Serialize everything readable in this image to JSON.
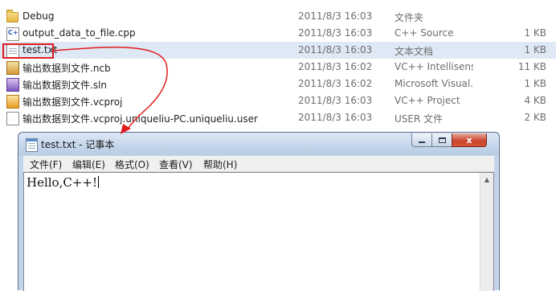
{
  "files": [
    {
      "name": "Debug",
      "date": "2011/8/3 16:03",
      "type": "文件夹",
      "size": "",
      "icon": "folder-icon"
    },
    {
      "name": "output_data_to_file.cpp",
      "date": "2011/8/3 16:03",
      "type": "C++ Source",
      "size": "1 KB",
      "icon": "cpp-file-icon"
    },
    {
      "name": "test.txt",
      "date": "2011/8/3 16:03",
      "type": "文本文档",
      "size": "1 KB",
      "icon": "text-file-icon"
    },
    {
      "name": "输出数据到文件.ncb",
      "date": "2011/8/3 16:02",
      "type": "VC++ Intellisens...",
      "size": "11 KB",
      "icon": "ncb-file-icon"
    },
    {
      "name": "输出数据到文件.sln",
      "date": "2011/8/3 16:02",
      "type": "Microsoft Visual...",
      "size": "1 KB",
      "icon": "sln-file-icon"
    },
    {
      "name": "输出数据到文件.vcproj",
      "date": "2011/8/3 16:03",
      "type": "VC++ Project",
      "size": "4 KB",
      "icon": "vcproj-file-icon"
    },
    {
      "name": "输出数据到文件.vcproj.uniqueliu-PC.uniqueliu.user",
      "date": "2011/8/3 16:03",
      "type": "USER 文件",
      "size": "2 KB",
      "icon": "user-file-icon"
    }
  ],
  "selected_file_index": 2,
  "notepad": {
    "title": "test.txt - 记事本",
    "minimize": "",
    "maximize": "",
    "close": "x",
    "menu": [
      "文件(F)",
      "编辑(E)",
      "格式(O)",
      "查看(V)",
      "帮助(H)"
    ],
    "content": "Hello,C++!"
  },
  "colors": {
    "annotation_red": "#e01d1d",
    "selection_blue": "#dfe8f5",
    "window_frame": "#c4d5ea"
  }
}
